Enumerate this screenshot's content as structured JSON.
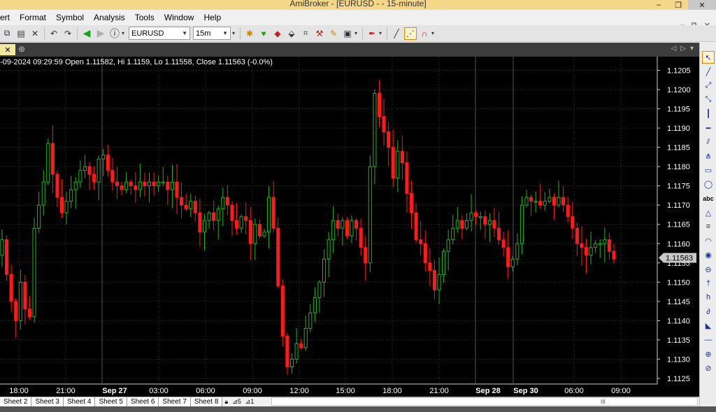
{
  "window": {
    "title": "AmiBroker - [EURUSD -  - 15-minute]",
    "min_label": "–",
    "max_label": "❐",
    "close_label": "✕"
  },
  "menu": [
    "ert",
    "Format",
    "Symbol",
    "Analysis",
    "Tools",
    "Window",
    "Help"
  ],
  "menu_right": [
    "–",
    "⧉",
    "✕"
  ],
  "toolbar": {
    "symbol": "EURUSD",
    "interval": "15m"
  },
  "chart_header": "-09-2024 09:29:59 Open 1.11582, Hi 1.1159, Lo 1.11558, Close 1.11563 (-0.0%)",
  "colors": {
    "up": "#22b422",
    "down": "#ff1a1a",
    "grid": "#3a3a3a",
    "axis_text": "#ffffff",
    "last_price_bg": "#c8c8c8"
  },
  "chart_data": {
    "type": "candlestick",
    "title": "",
    "ylim": [
      1.1122,
      1.1208
    ],
    "y_ticks": [
      1.1125,
      1.113,
      1.1135,
      1.114,
      1.1145,
      1.115,
      1.1155,
      1.116,
      1.1165,
      1.117,
      1.1175,
      1.118,
      1.1185,
      1.119,
      1.1195,
      1.12,
      1.1205
    ],
    "y_tick_labels": [
      "1.1125",
      "1.1130",
      "1.1135",
      "1.1140",
      "1.1145",
      "1.1150",
      "1.1155",
      "1.1160",
      "1.1165",
      "1.1170",
      "1.1175",
      "1.1180",
      "1.1185",
      "1.1190",
      "1.1195",
      "1.1200",
      "1.1205"
    ],
    "x_labels": [
      "18:00",
      "21:00",
      "Sep 27",
      "03:00",
      "06:00",
      "09:00",
      "12:00",
      "15:00",
      "18:00",
      "21:00",
      "Sep 28",
      "Sep 30",
      "06:00",
      "09:00"
    ],
    "bold_x_labels": [
      "Sep 27",
      "Sep 28",
      "Sep 30"
    ],
    "last_price_label": "1.11563",
    "last_price": 1.11563,
    "closes": [
      1.1161,
      1.1152,
      1.1145,
      1.114,
      1.115,
      1.1143,
      1.1141,
      1.1164,
      1.117,
      1.1176,
      1.1186,
      1.1178,
      1.1172,
      1.1168,
      1.1171,
      1.1174,
      1.1176,
      1.1179,
      1.118,
      1.1178,
      1.1176,
      1.1182,
      1.1183,
      1.1179,
      1.1176,
      1.1175,
      1.1174,
      1.1176,
      1.1175,
      1.1174,
      1.1176,
      1.1175,
      1.1176,
      1.1175,
      1.1176,
      1.1176,
      1.1174,
      1.1176,
      1.1172,
      1.117,
      1.1169,
      1.1171,
      1.1168,
      1.1163,
      1.1166,
      1.1168,
      1.1166,
      1.1169,
      1.1172,
      1.117,
      1.1166,
      1.1164,
      1.1167,
      1.1166,
      1.116,
      1.1165,
      1.1162,
      1.1163,
      1.1172,
      1.1164,
      1.1149,
      1.1136,
      1.1128,
      1.113,
      1.1134,
      1.1133,
      1.1138,
      1.1142,
      1.1146,
      1.115,
      1.1156,
      1.1161,
      1.1166,
      1.1164,
      1.1166,
      1.1162,
      1.1166,
      1.1164,
      1.1159,
      1.1155,
      1.118,
      1.1199,
      1.1193,
      1.1189,
      1.1185,
      1.1177,
      1.1184,
      1.1181,
      1.1173,
      1.1168,
      1.1161,
      1.116,
      1.1155,
      1.1153,
      1.1148,
      1.1152,
      1.1158,
      1.1161,
      1.1164,
      1.1166,
      1.1164,
      1.1166,
      1.1168,
      1.1167,
      1.1167,
      1.1165,
      1.1166,
      1.1164,
      1.1161,
      1.1159,
      1.1154,
      1.1156,
      1.116,
      1.117,
      1.1172,
      1.1171,
      1.1171,
      1.117,
      1.1171,
      1.1172,
      1.117,
      1.1172,
      1.117,
      1.1167,
      1.1164,
      1.116,
      1.1159,
      1.1157,
      1.1159,
      1.116,
      1.116,
      1.1161,
      1.1158,
      1.1156
    ]
  },
  "draw_tools": [
    {
      "name": "select-arrow-icon",
      "glyph": "↖",
      "selected": true
    },
    {
      "name": "line-tool-icon",
      "glyph": "╱"
    },
    {
      "name": "ray-tool-icon",
      "glyph": "⤢"
    },
    {
      "name": "extended-line-icon",
      "glyph": "⤡"
    },
    {
      "name": "vertical-line-icon",
      "glyph": "┃"
    },
    {
      "name": "horizontal-line-icon",
      "glyph": "━"
    },
    {
      "name": "parallel-lines-icon",
      "glyph": "⫽"
    },
    {
      "name": "andrews-pitchfork-icon",
      "glyph": "⋔"
    },
    {
      "name": "rectangle-icon",
      "glyph": "▭"
    },
    {
      "name": "ellipse-icon",
      "glyph": "◯"
    },
    {
      "name": "text-tool-icon",
      "glyph": "abc"
    },
    {
      "name": "triangle-icon",
      "glyph": "△"
    },
    {
      "name": "fibonacci-icon",
      "glyph": "≡"
    },
    {
      "name": "arc-icon",
      "glyph": "◠"
    },
    {
      "name": "cycle-icon",
      "glyph": "◉"
    },
    {
      "name": "time-zone-icon",
      "glyph": "⊖"
    },
    {
      "name": "note-icon",
      "glyph": "†"
    },
    {
      "name": "pen-icon",
      "glyph": "h"
    },
    {
      "name": "marker-icon",
      "glyph": "∂"
    },
    {
      "name": "eraser-icon",
      "glyph": "◣"
    },
    {
      "name": "hline-icon",
      "glyph": "—"
    },
    {
      "name": "channel-icon",
      "glyph": "⊕"
    },
    {
      "name": "linear-reg-icon",
      "glyph": "⊘"
    }
  ],
  "sheets": [
    "Sheet 2",
    "Sheet 3",
    "Sheet 4",
    "Sheet 5",
    "Sheet 6",
    "Sheet 7",
    "Sheet 8"
  ],
  "sheet_controls": [
    "⊿5",
    "⊿1"
  ],
  "scroll_thumb": "III"
}
